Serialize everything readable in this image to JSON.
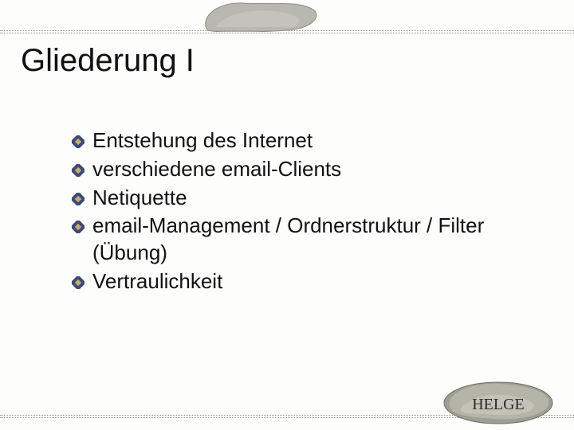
{
  "slide": {
    "title": "Gliederung I",
    "bullets": [
      {
        "text": "Entstehung des Internet"
      },
      {
        "text": "verschiedene email-Clients"
      },
      {
        "text": "Netiquette"
      },
      {
        "text": "email-Management / Ordnerstruktur / Filter (Übung)"
      },
      {
        "text": "Vertraulichkeit"
      }
    ],
    "logo_text": "HELGE"
  },
  "colors": {
    "bullet_outer": "#3b4a7a",
    "bullet_inner": "#c9a86a"
  }
}
